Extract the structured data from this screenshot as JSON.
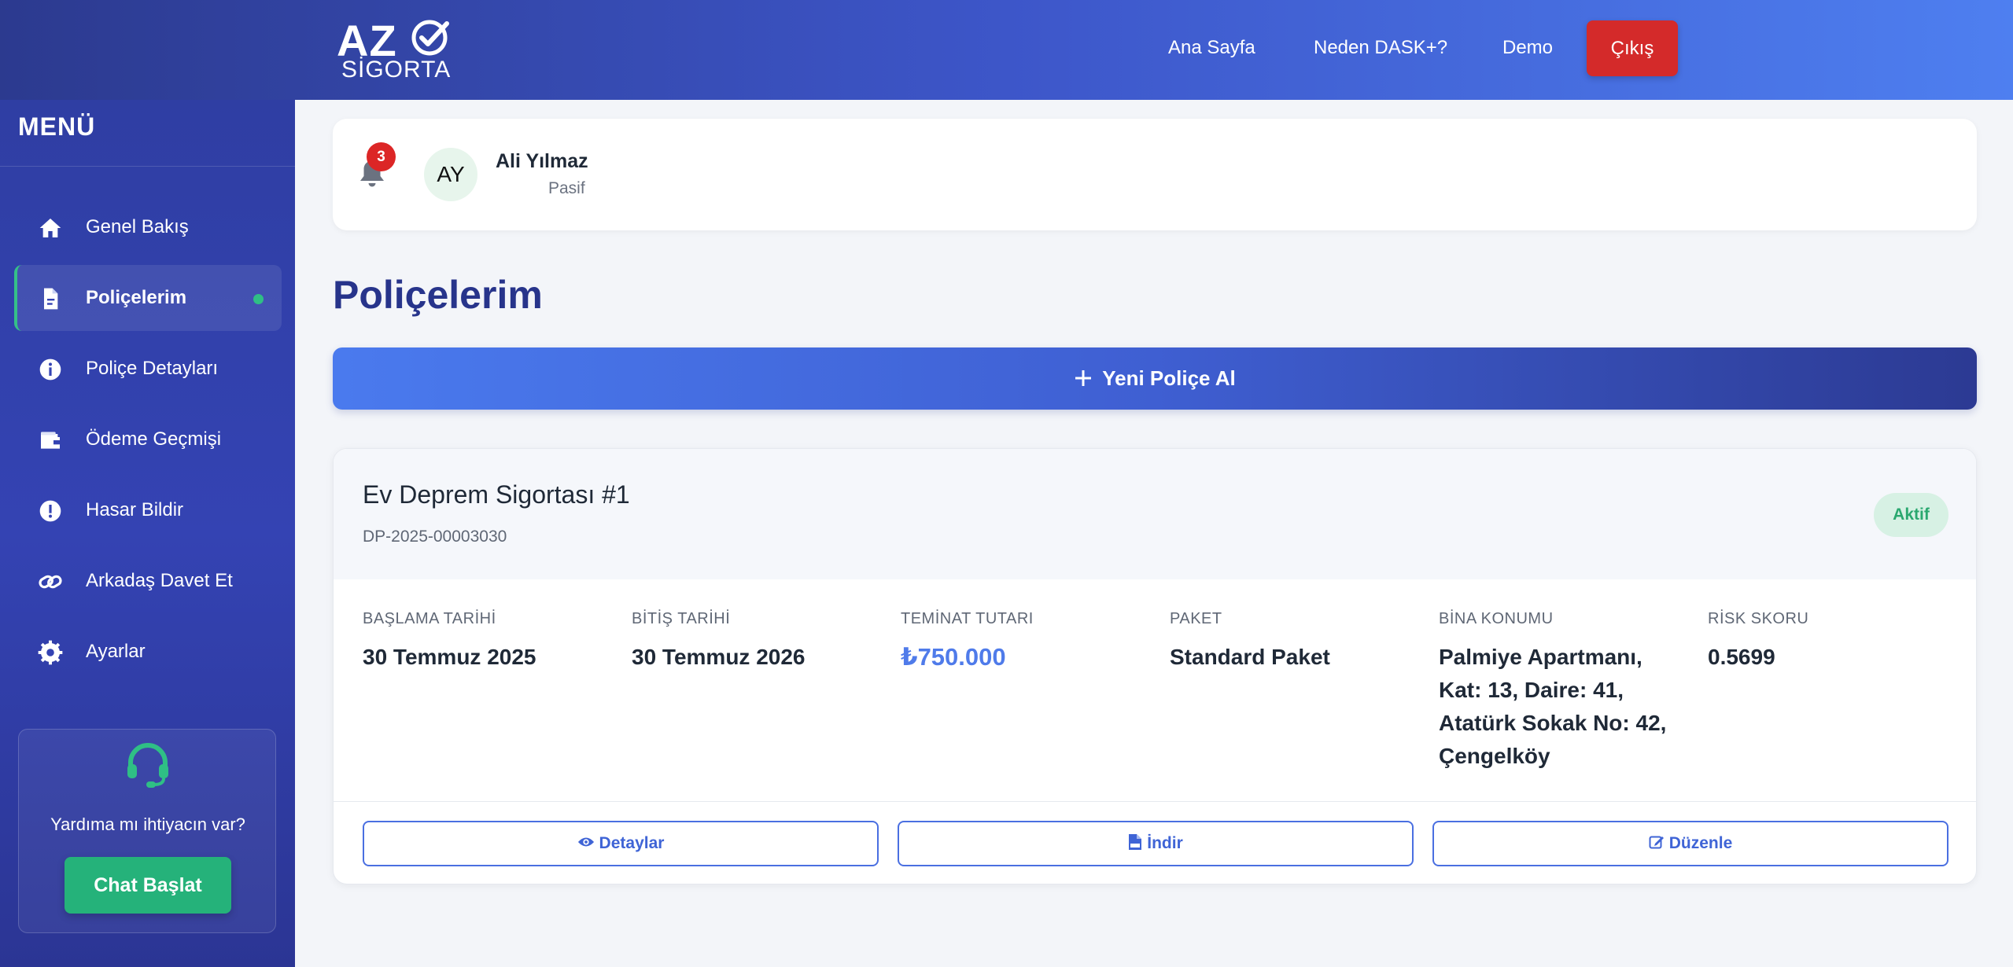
{
  "header": {
    "logo_top": "AZ",
    "logo_bottom": "SİGORTA",
    "nav": {
      "home": "Ana Sayfa",
      "why": "Neden DASK+?",
      "demo": "Demo"
    },
    "logout_label": "Çıkış",
    "logout_color": "#d42a2a"
  },
  "sidebar": {
    "title": "MENÜ",
    "items": [
      {
        "label": "Genel Bakış",
        "icon": "home-icon"
      },
      {
        "label": "Poliçelerim",
        "icon": "document-icon",
        "active": true
      },
      {
        "label": "Poliçe Detayları",
        "icon": "info-icon"
      },
      {
        "label": "Ödeme Geçmişi",
        "icon": "wallet-icon"
      },
      {
        "label": "Hasar Bildir",
        "icon": "alert-icon"
      },
      {
        "label": "Arkadaş Davet Et",
        "icon": "link-icon"
      },
      {
        "label": "Ayarlar",
        "icon": "gear-icon"
      }
    ],
    "help": {
      "text": "Yardıma mı ihtiyacın var?",
      "button": "Chat Başlat",
      "icon": "headset-icon"
    }
  },
  "profile": {
    "notification_count": "3",
    "initials": "AY",
    "name": "Ali Yılmaz",
    "status": "Pasif"
  },
  "main": {
    "title": "Poliçelerim",
    "new_policy_button": "Yeni Poliçe Al",
    "policy": {
      "name": "Ev Deprem Sigortası #1",
      "number": "DP-2025-00003030",
      "status": "Aktif",
      "fields": {
        "start_label": "BAŞLAMA TARİHİ",
        "start_value": "30 Temmuz 2025",
        "end_label": "BİTİŞ TARİHİ",
        "end_value": "30 Temmuz 2026",
        "coverage_label": "TEMİNAT TUTARI",
        "coverage_value": "₺750.000",
        "package_label": "PAKET",
        "package_value": "Standard Paket",
        "location_label": "BİNA KONUMU",
        "location_value": "Palmiye Apartmanı, Kat: 13, Daire: 41, Atatürk Sokak No: 42, Çengelköy",
        "risk_label": "RİSK SKORU",
        "risk_value": "0.5699"
      },
      "actions": {
        "details": "Detaylar",
        "download": "İndir",
        "edit": "Düzenle"
      }
    }
  },
  "colors": {
    "accent": "#27348b",
    "primary": "#4a7aee",
    "success": "#2fbf85",
    "danger": "#dc2626"
  }
}
